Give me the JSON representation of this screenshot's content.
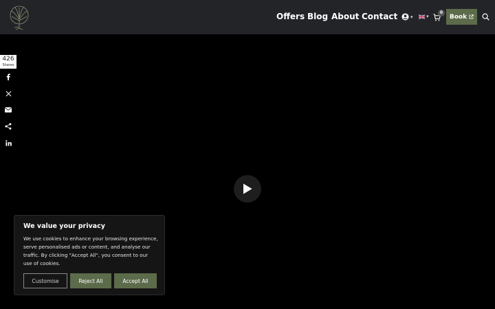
{
  "header": {
    "nav": [
      {
        "label": "Offers"
      },
      {
        "label": "Blog"
      },
      {
        "label": "About"
      },
      {
        "label": "Contact"
      }
    ],
    "cart_count": "0",
    "book_label": "Book"
  },
  "share": {
    "count": "426",
    "count_label": "Shares",
    "buttons": [
      "facebook-icon",
      "x-icon",
      "email-icon",
      "share-icon",
      "linkedin-icon"
    ]
  },
  "cookie": {
    "title": "We value your privacy",
    "text": "We use cookies to enhance your browsing experience, serve personalised ads or content, and analyse our traffic. By clicking \"Accept All\", you consent to our use of cookies.",
    "customise_label": "Customise",
    "reject_label": "Reject All",
    "accept_label": "Accept All"
  },
  "colors": {
    "header_bg": "#222428",
    "accent": "#5c6b4a"
  }
}
